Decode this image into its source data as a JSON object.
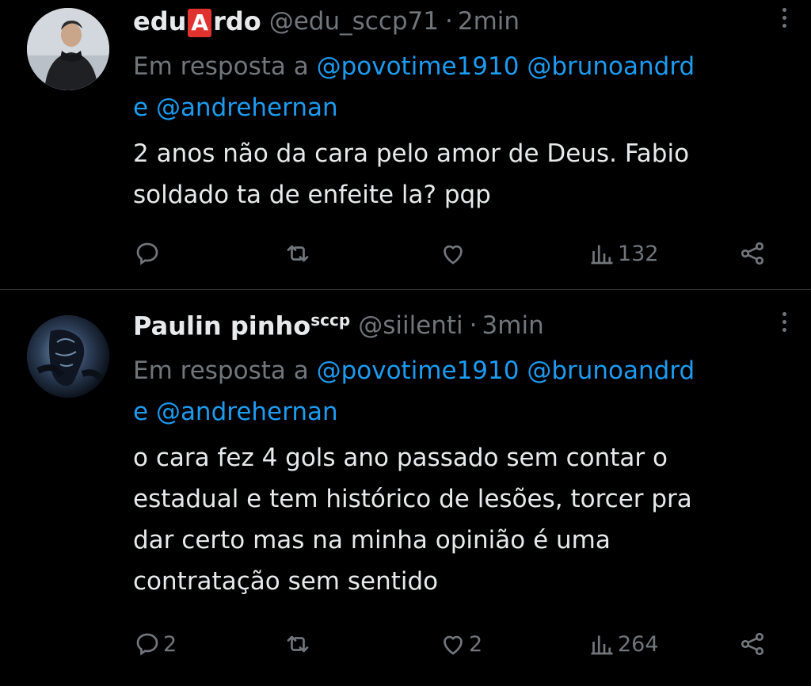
{
  "tweets": [
    {
      "name_pre": "edu",
      "name_box": "A",
      "name_post": "rdo",
      "handle": "@edu_sccp71",
      "separator": "·",
      "time": "2min",
      "reply_prefix": "Em resposta a",
      "mentions": [
        "@povotime1910",
        "@brunoandrd",
        "e",
        "@andrehernan"
      ],
      "text_lines": [
        "2 anos não da cara pelo amor de Deus. Fabio",
        "soldado ta de enfeite la? pqp"
      ],
      "actions": {
        "reply": "",
        "retweet": "",
        "like": "",
        "views": "132"
      }
    },
    {
      "name": "Paulin pinho",
      "name_sup": "sccp",
      "handle": "@siilenti",
      "separator": "·",
      "time": "3min",
      "reply_prefix": "Em resposta a",
      "mentions": [
        "@povotime1910",
        "@brunoandrd",
        "e",
        "@andrehernan"
      ],
      "text_lines": [
        "o cara fez 4 gols ano passado sem contar o",
        "estadual e tem histórico de lesões, torcer pra",
        "dar certo mas na minha opinião é uma",
        "contratação sem sentido"
      ],
      "actions": {
        "reply": "2",
        "retweet": "",
        "like": "2",
        "views": "264"
      }
    }
  ],
  "colors": {
    "background": "#000000",
    "text": "#e7e9ea",
    "muted": "#71767b",
    "link": "#1d9bf0",
    "divider": "#2f3336",
    "badge": "#e0322f"
  },
  "icons": [
    "more-vertical-icon",
    "reply-icon",
    "retweet-icon",
    "like-icon",
    "views-icon",
    "share-icon"
  ]
}
